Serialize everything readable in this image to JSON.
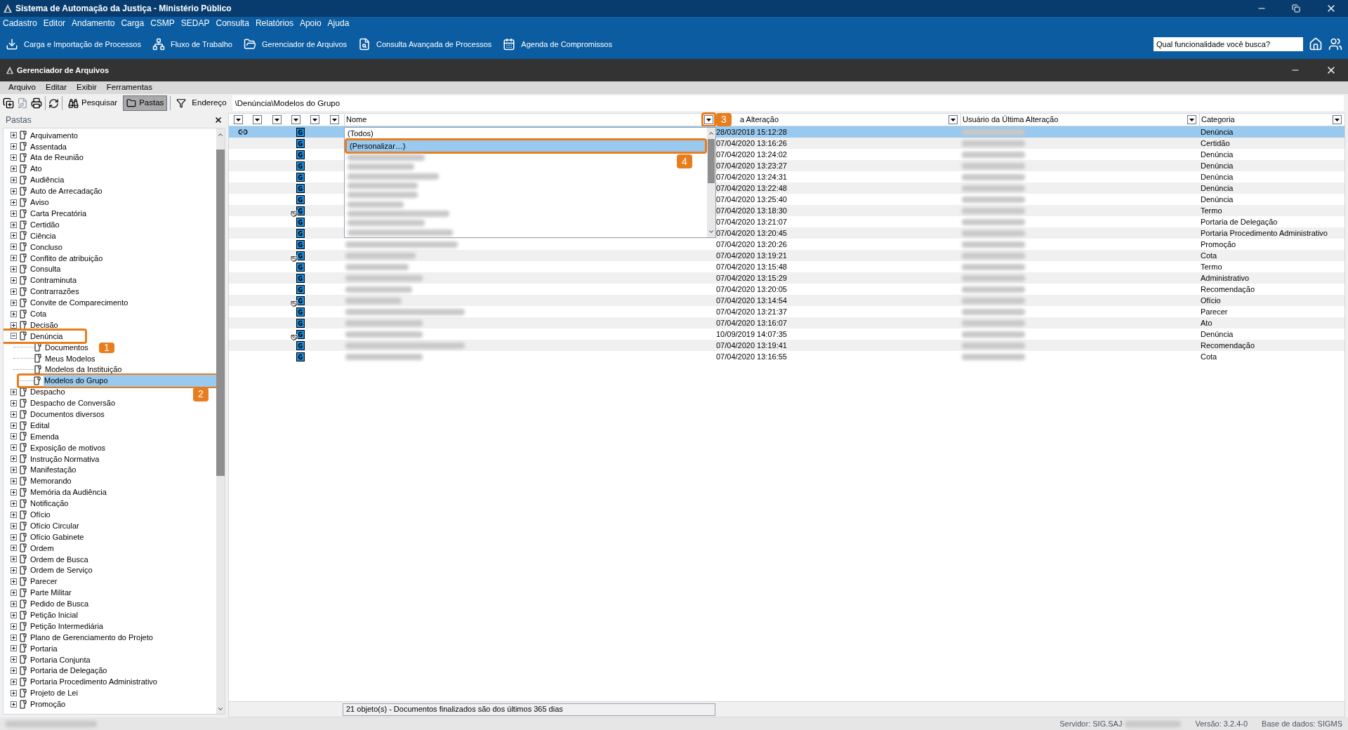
{
  "window": {
    "title": "Sistema de Automação da Justiça - Ministério Público"
  },
  "menu": [
    "Cadastro",
    "Editor",
    "Andamento",
    "Carga",
    "CSMP",
    "SEDAP",
    "Consulta",
    "Relatórios",
    "Apoio",
    "Ajuda"
  ],
  "toolbar": [
    {
      "label": "Carga e Importação de Processos",
      "kind": "import"
    },
    {
      "label": "Fluxo de Trabalho",
      "kind": "flow"
    },
    {
      "label": "Gerenciador de Arquivos",
      "kind": "files"
    },
    {
      "label": "Consulta Avançada de Processos",
      "kind": "search"
    },
    {
      "label": "Agenda de Compromissos",
      "kind": "calendar"
    }
  ],
  "search": {
    "placeholder": "Qual funcionalidade você busca?"
  },
  "inner_window": {
    "title": "Gerenciador de Arquivos",
    "menu": [
      "Arquivo",
      "Editar",
      "Exibir",
      "Ferramentas"
    ],
    "toolbar": [
      {
        "label": "Pesquisar",
        "selected": false
      },
      {
        "label": "Pastas",
        "selected": true
      }
    ],
    "address": {
      "label": "Endereço",
      "value": "\\Denúncia\\Modelos do Grupo"
    }
  },
  "sidebar": {
    "title": "Pastas",
    "items": [
      {
        "label": "Arquivamento",
        "expanded": false,
        "selected": false
      },
      {
        "label": "Assentada",
        "expanded": false,
        "selected": false
      },
      {
        "label": "Ata de Reunião",
        "expanded": false,
        "selected": false
      },
      {
        "label": "Ato",
        "expanded": false,
        "selected": false
      },
      {
        "label": "Audiência",
        "expanded": false,
        "selected": false
      },
      {
        "label": "Auto de Arrecadação",
        "expanded": false,
        "selected": false
      },
      {
        "label": "Aviso",
        "expanded": false,
        "selected": false
      },
      {
        "label": "Carta Precatória",
        "expanded": false,
        "selected": false
      },
      {
        "label": "Certidão",
        "expanded": false,
        "selected": false
      },
      {
        "label": "Ciência",
        "expanded": false,
        "selected": false
      },
      {
        "label": "Concluso",
        "expanded": false,
        "selected": false
      },
      {
        "label": "Conflito de atribuição",
        "expanded": false,
        "selected": false
      },
      {
        "label": "Consulta",
        "expanded": false,
        "selected": false
      },
      {
        "label": "Contraminuta",
        "expanded": false,
        "selected": false
      },
      {
        "label": "Contrarrazões",
        "expanded": false,
        "selected": false
      },
      {
        "label": "Convite de Comparecimento",
        "expanded": false,
        "selected": false
      },
      {
        "label": "Cota",
        "expanded": false,
        "selected": false
      },
      {
        "label": "Decisão",
        "expanded": false,
        "selected": false
      },
      {
        "label": "Denúncia",
        "expanded": true,
        "selected": false,
        "children": [
          {
            "label": "Documentos",
            "selected": false
          },
          {
            "label": "Meus Modelos",
            "selected": false
          },
          {
            "label": "Modelos da Instituição",
            "selected": false
          },
          {
            "label": "Modelos do Grupo",
            "selected": true
          }
        ]
      },
      {
        "label": "Despacho",
        "expanded": false,
        "selected": false
      },
      {
        "label": "Despacho de Conversão",
        "expanded": false,
        "selected": false
      },
      {
        "label": "Documentos diversos",
        "expanded": false,
        "selected": false
      },
      {
        "label": "Edital",
        "expanded": false,
        "selected": false
      },
      {
        "label": "Emenda",
        "expanded": false,
        "selected": false
      },
      {
        "label": "Exposição de motivos",
        "expanded": false,
        "selected": false
      },
      {
        "label": "Instrução Normativa",
        "expanded": false,
        "selected": false
      },
      {
        "label": "Manifestação",
        "expanded": false,
        "selected": false
      },
      {
        "label": "Memorando",
        "expanded": false,
        "selected": false
      },
      {
        "label": "Memória da Audiência",
        "expanded": false,
        "selected": false
      },
      {
        "label": "Notificação",
        "expanded": false,
        "selected": false
      },
      {
        "label": "Ofício",
        "expanded": false,
        "selected": false
      },
      {
        "label": "Ofício Circular",
        "expanded": false,
        "selected": false
      },
      {
        "label": "Ofício Gabinete",
        "expanded": false,
        "selected": false
      },
      {
        "label": "Ordem",
        "expanded": false,
        "selected": false
      },
      {
        "label": "Ordem de Busca",
        "expanded": false,
        "selected": false
      },
      {
        "label": "Ordem de Serviço",
        "expanded": false,
        "selected": false
      },
      {
        "label": "Parecer",
        "expanded": false,
        "selected": false
      },
      {
        "label": "Parte Militar",
        "expanded": false,
        "selected": false
      },
      {
        "label": "Pedido de Busca",
        "expanded": false,
        "selected": false
      },
      {
        "label": "Petição Inicial",
        "expanded": false,
        "selected": false
      },
      {
        "label": "Petição Intermediária",
        "expanded": false,
        "selected": false
      },
      {
        "label": "Plano de Gerenciamento do Projeto",
        "expanded": false,
        "selected": false
      },
      {
        "label": "Portaria",
        "expanded": false,
        "selected": false
      },
      {
        "label": "Portaria Conjunta",
        "expanded": false,
        "selected": false
      },
      {
        "label": "Portaria de Delegação",
        "expanded": false,
        "selected": false
      },
      {
        "label": "Portaria Procedimento Administrativo",
        "expanded": false,
        "selected": false
      },
      {
        "label": "Projeto de Lei",
        "expanded": false,
        "selected": false
      },
      {
        "label": "Promoção",
        "expanded": false,
        "selected": false
      }
    ]
  },
  "table": {
    "columns": [
      "Nome",
      "a Alteração",
      "Usuário da Última Alteração",
      "Categoria"
    ],
    "filter": {
      "options": [
        {
          "label": "(Todos)",
          "selected": false
        },
        {
          "label": "(Personalizar…)",
          "selected": true
        }
      ]
    },
    "rows": [
      {
        "date": "28/03/2018 15:12:28",
        "category": "Denúncia",
        "selected": true,
        "linked": true,
        "shared": false
      },
      {
        "date": "07/04/2020 13:16:26",
        "category": "Certidão",
        "selected": false,
        "linked": false,
        "shared": false
      },
      {
        "date": "07/04/2020 13:24:02",
        "category": "Denúncia",
        "selected": false,
        "linked": false,
        "shared": false
      },
      {
        "date": "07/04/2020 13:23:27",
        "category": "Denúncia",
        "selected": false,
        "linked": false,
        "shared": false
      },
      {
        "date": "07/04/2020 13:24:31",
        "category": "Denúncia",
        "selected": false,
        "linked": false,
        "shared": false
      },
      {
        "date": "07/04/2020 13:22:48",
        "category": "Denúncia",
        "selected": false,
        "linked": false,
        "shared": false
      },
      {
        "date": "07/04/2020 13:25:40",
        "category": "Denúncia",
        "selected": false,
        "linked": false,
        "shared": false
      },
      {
        "date": "07/04/2020 13:18:30",
        "category": "Termo",
        "selected": false,
        "linked": false,
        "shared": true
      },
      {
        "date": "07/04/2020 13:21:07",
        "category": "Portaria de Delegação",
        "selected": false,
        "linked": false,
        "shared": false
      },
      {
        "date": "07/04/2020 13:20:45",
        "category": "Portaria Procedimento Administrativo",
        "selected": false,
        "linked": false,
        "shared": false
      },
      {
        "date": "07/04/2020 13:20:26",
        "category": "Promoção",
        "selected": false,
        "linked": false,
        "shared": false
      },
      {
        "date": "07/04/2020 13:19:21",
        "category": "Cota",
        "selected": false,
        "linked": false,
        "shared": true
      },
      {
        "date": "07/04/2020 13:15:48",
        "category": "Termo",
        "selected": false,
        "linked": false,
        "shared": false
      },
      {
        "date": "07/04/2020 13:15:29",
        "category": "Administrativo",
        "selected": false,
        "linked": false,
        "shared": false
      },
      {
        "date": "07/04/2020 13:20:05",
        "category": "Recomendação",
        "selected": false,
        "linked": false,
        "shared": false
      },
      {
        "date": "07/04/2020 13:14:54",
        "category": "Ofício",
        "selected": false,
        "linked": false,
        "shared": true
      },
      {
        "date": "07/04/2020 13:21:37",
        "category": "Parecer",
        "selected": false,
        "linked": false,
        "shared": false
      },
      {
        "date": "07/04/2020 13:16:07",
        "category": "Ato",
        "selected": false,
        "linked": false,
        "shared": false
      },
      {
        "date": "10/09/2019 14:07:35",
        "category": "Denúncia",
        "selected": false,
        "linked": false,
        "shared": true
      },
      {
        "date": "07/04/2020 13:19:41",
        "category": "Recomendação",
        "selected": false,
        "linked": false,
        "shared": false
      },
      {
        "date": "07/04/2020 13:16:55",
        "category": "Cota",
        "selected": false,
        "linked": false,
        "shared": false
      }
    ],
    "status": "21 objeto(s) - Documentos finalizados são dos últimos 365 dias"
  },
  "status_bar": {
    "server": "Servidor: SIG.SAJ",
    "version": "Versão: 3.2.4-0",
    "database": "Base de dados: SIGMS"
  },
  "callouts": [
    "1",
    "2",
    "3",
    "4"
  ]
}
